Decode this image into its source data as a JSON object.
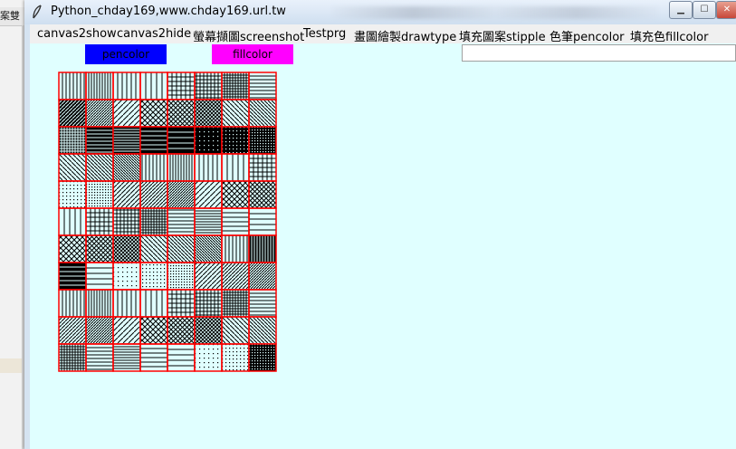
{
  "background": {
    "left_window_text": "案雙"
  },
  "window": {
    "title": "Python_chday169,www.chday169.url.tw",
    "min_label": "▁",
    "max_label": "☐",
    "close_label": "✕"
  },
  "menu": {
    "items": [
      "canvas2show",
      "canvas2hide",
      "螢幕擷圖screenshot",
      "Testprg",
      "畫圖繪製drawtype",
      "填充圖案stipple",
      "色筆pencolor",
      "填充色fillcolor"
    ]
  },
  "toolbar": {
    "pencolor_label": "pencolor",
    "fillcolor_label": "fillcolor",
    "pencolor_value": "#0000ff",
    "fillcolor_value": "#ff00ff",
    "entry_value": ""
  },
  "stipple_grid": {
    "rows": 11,
    "cols": 8,
    "cell_stroke": "#ff0000",
    "fill": "#000000",
    "background": "#e0ffff"
  }
}
